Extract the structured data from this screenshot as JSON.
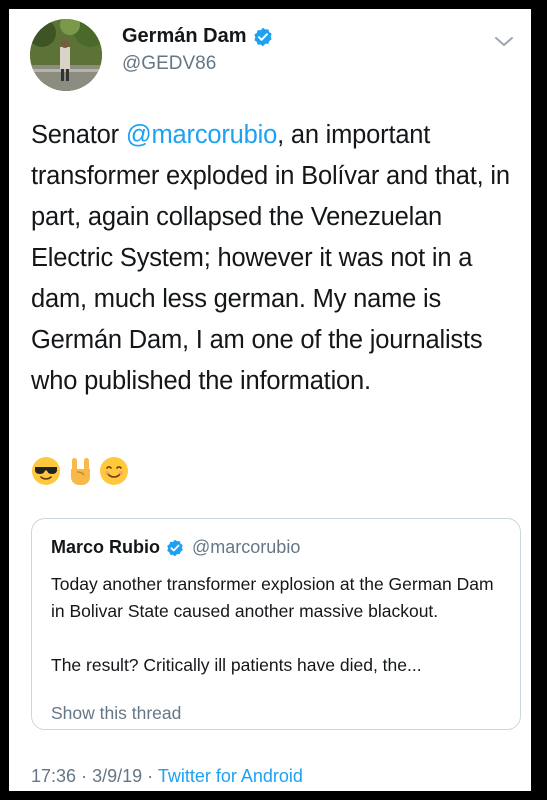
{
  "author": {
    "name": "Germán Dam",
    "handle": "@GEDV86",
    "verified": true
  },
  "tweet": {
    "text_before": "Senator ",
    "mention": "@marcorubio",
    "text_after": ", an important transformer exploded in Bolívar and that, in part, again collapsed the Venezuelan Electric System; however it was not in a dam, much less german. My name is Germán Dam, I am one of the journalists who published the information.",
    "emojis": [
      "sunglasses-face",
      "rock-on-hand",
      "smiling-face"
    ]
  },
  "quoted_tweet": {
    "name": "Marco Rubio",
    "handle": "@marcorubio",
    "verified": true,
    "text": "Today another transformer explosion at the German Dam in Bolivar State caused another massive blackout.\n\nThe result? Critically ill patients have died, the...",
    "show_thread": "Show this thread"
  },
  "meta": {
    "time": "17:36",
    "date": "3/9/19",
    "separator": "·",
    "source": "Twitter for Android"
  },
  "colors": {
    "accent": "#1da1f2",
    "secondary_text": "#657786",
    "border": "#ccd6dd"
  }
}
